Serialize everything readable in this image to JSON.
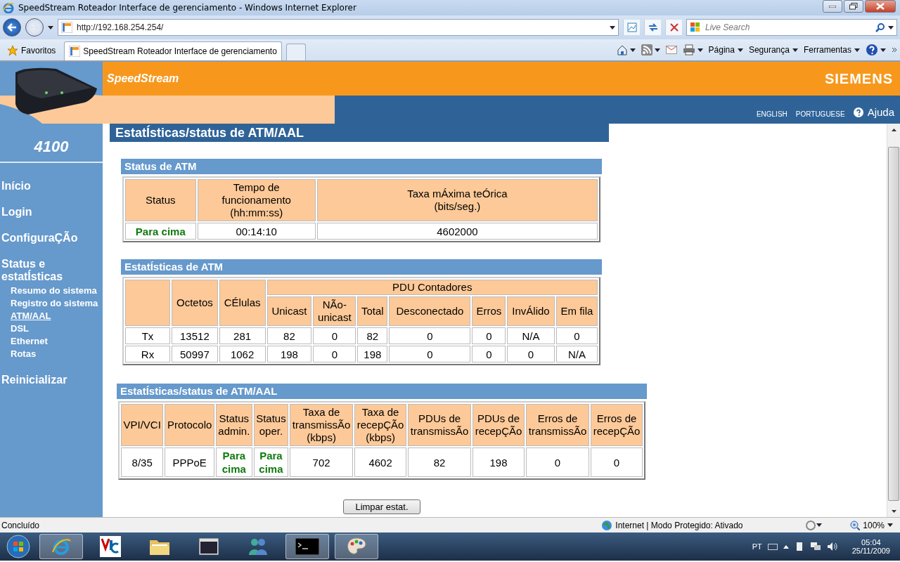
{
  "window": {
    "title": "SpeedStream Roteador Interface de gerenciamento - Windows Internet Explorer"
  },
  "address_bar": {
    "url": "http://192.168.254.254/"
  },
  "search": {
    "placeholder": "Live Search"
  },
  "favorites": {
    "label": "Favoritos"
  },
  "tabs": [
    {
      "label": "SpeedStream Roteador Interface de gerenciamento",
      "selected": true
    }
  ],
  "command_bar": {
    "menus": [
      "Página",
      "Segurança",
      "Ferramentas"
    ]
  },
  "page": {
    "brand": "SpeedStream",
    "vendor": "SIEMENS",
    "languages": [
      "ENGLISH",
      "PORTUGUESE"
    ],
    "help": "Ajuda",
    "model": "4100",
    "nav": [
      {
        "label": "Início"
      },
      {
        "label": "Login"
      },
      {
        "label": "ConfiguraÇÃo"
      },
      {
        "label": "Status e estatÍsticas",
        "children": [
          {
            "label": "Resumo do sistema",
            "selected": false
          },
          {
            "label": "Registro do sistema",
            "selected": false
          },
          {
            "label": "ATM/AAL",
            "selected": true
          },
          {
            "label": "DSL",
            "selected": false
          },
          {
            "label": "Ethernet",
            "selected": false
          },
          {
            "label": "Rotas",
            "selected": false
          }
        ]
      },
      {
        "label": "Reinicializar"
      }
    ],
    "title": "EstatÍsticas/status de ATM/AAL",
    "atm_status": {
      "title": "Status de ATM",
      "columns": [
        "Status",
        "Tempo de\nfuncionamento\n(hh:mm:ss)",
        "Taxa mÁxima teÓrica\n(bits/seg.)"
      ],
      "rows": [
        [
          {
            "text": "Para cima",
            "kind": "status"
          },
          {
            "text": "00:14:10",
            "kind": "plain"
          },
          {
            "text": "4602000",
            "kind": "plain"
          }
        ]
      ]
    },
    "atm_stats": {
      "title": "EstatÍsticas de ATM",
      "columns": [
        "Octetos",
        "CÉlulas"
      ],
      "group": {
        "label": "PDU Contadores",
        "columns": [
          "Unicast",
          "NÃo-\nunicast",
          "Total",
          "Desconectado",
          "Erros",
          "InvÁlido",
          "Em fila"
        ]
      },
      "rows": [
        {
          "label": "Tx",
          "cells": [
            "13512",
            "281",
            "82",
            "0",
            "82",
            "0",
            "0",
            "N/A",
            "0"
          ]
        },
        {
          "label": "Rx",
          "cells": [
            "50997",
            "1062",
            "198",
            "0",
            "198",
            "0",
            "0",
            "0",
            "N/A"
          ]
        }
      ]
    },
    "aal_stats": {
      "title": "EstatÍsticas/status de ATM/AAL",
      "columns": [
        "VPI/VCI",
        "Protocolo",
        "Status\nadmin.",
        "Status\noper.",
        "Taxa de\ntransmissÃo\n(kbps)",
        "Taxa de\nrecepÇÃo\n(kbps)",
        "PDUs de\ntransmissÃo",
        "PDUs de\nrecepÇÃo",
        "Erros de\ntransmissÃo",
        "Erros de\nrecepÇÃo"
      ],
      "rows": [
        [
          {
            "text": "8/35",
            "kind": "plain"
          },
          {
            "text": "PPPoE",
            "kind": "plain"
          },
          {
            "text": "Para\ncima",
            "kind": "status"
          },
          {
            "text": "Para\ncima",
            "kind": "status"
          },
          {
            "text": "702",
            "kind": "plain"
          },
          {
            "text": "4602",
            "kind": "plain"
          },
          {
            "text": "82",
            "kind": "plain"
          },
          {
            "text": "198",
            "kind": "plain"
          },
          {
            "text": "0",
            "kind": "plain"
          },
          {
            "text": "0",
            "kind": "plain"
          }
        ]
      ]
    },
    "clear_button": "Limpar estat."
  },
  "status_bar": {
    "text": "Concluído",
    "zone": "Internet | Modo Protegido: Ativado",
    "zoom": "100%"
  },
  "taskbar": {
    "language": "PT",
    "time": "05:04",
    "date": "25/11/2009"
  }
}
